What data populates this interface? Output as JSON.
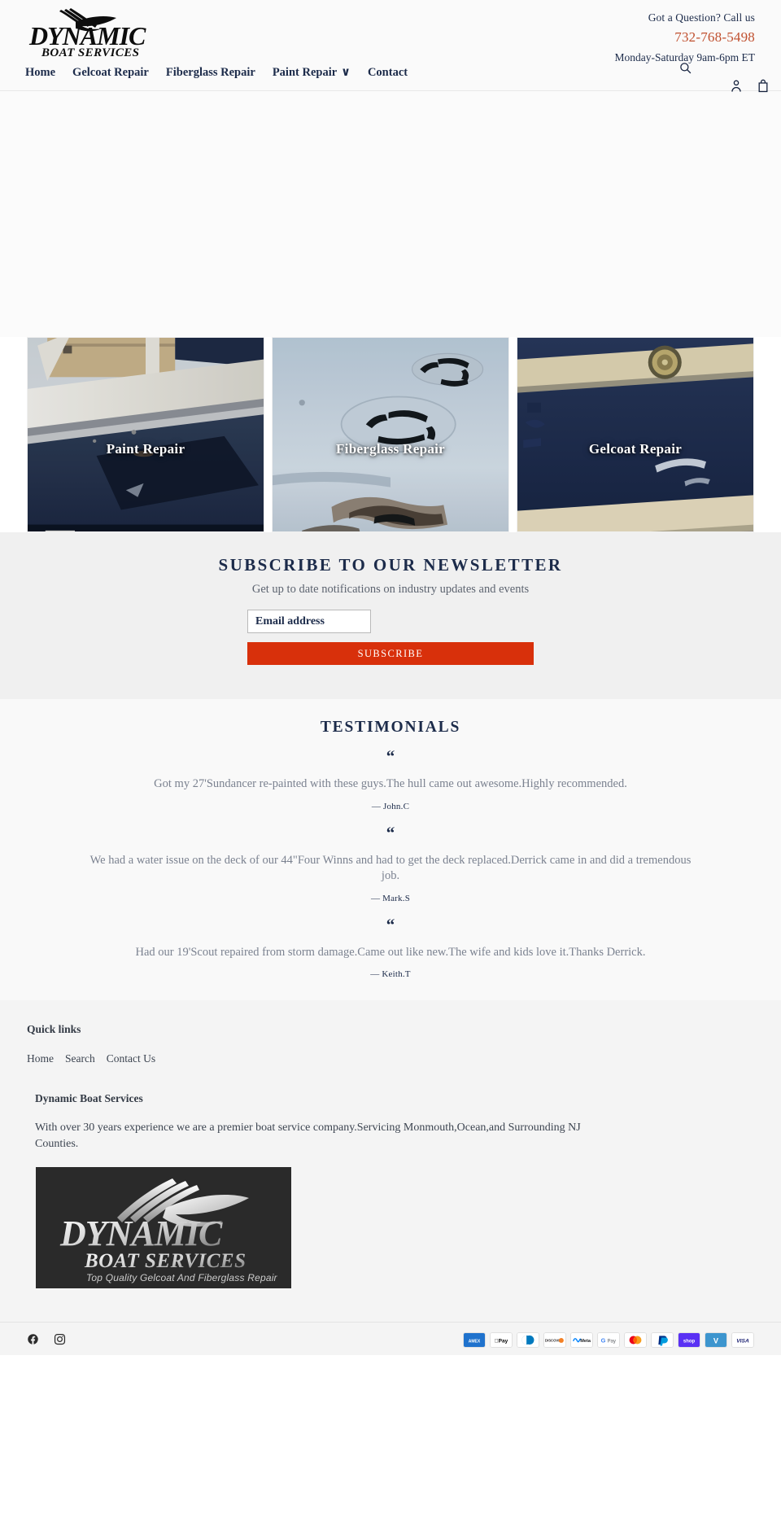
{
  "header": {
    "logo_alt": "Dynamic Boat Services",
    "logo_main": "DYNAMIC",
    "logo_sub": "BOAT SERVICES",
    "contact_prompt": "Got a Question? Call us",
    "phone": "732-768-5498",
    "hours": "Monday-Saturday 9am-6pm ET",
    "nav": [
      {
        "label": "Home",
        "has_caret": false
      },
      {
        "label": "Gelcoat Repair",
        "has_caret": false
      },
      {
        "label": "Fiberglass Repair",
        "has_caret": false
      },
      {
        "label": "Paint Repair",
        "has_caret": true
      },
      {
        "label": "Contact",
        "has_caret": false
      }
    ],
    "caret_glyph": "∨",
    "icons": {
      "search": "search-icon",
      "account": "account-icon",
      "cart": "cart-icon"
    }
  },
  "cards": [
    {
      "label": "Paint Repair"
    },
    {
      "label": "Fiberglass Repair"
    },
    {
      "label": "Gelcoat Repair"
    }
  ],
  "newsletter": {
    "title": "SUBSCRIBE TO OUR NEWSLETTER",
    "subtitle": "Get up to date notifications on industry updates and events",
    "email_placeholder": "Email address",
    "email_value": "",
    "submit_label": "SUBSCRIBE",
    "accent_color": "#d8300b"
  },
  "testimonials": {
    "title": "TESTIMONIALS",
    "quote_glyph": "“",
    "items": [
      {
        "text": "Got my 27'Sundancer re-painted with these guys.The hull came out awesome.Highly recommended.",
        "author": "— John.C"
      },
      {
        "text": "We had a water issue on the deck of our 44\"Four Winns and had to get the deck replaced.Derrick came in and did a tremendous job.",
        "author": "— Mark.S"
      },
      {
        "text": "Had our 19'Scout repaired from storm damage.Came out like new.The wife and kids love it.Thanks Derrick.",
        "author": "— Keith.T"
      }
    ]
  },
  "footer": {
    "quick_links_heading": "Quick links",
    "quick_links": [
      {
        "label": "Home"
      },
      {
        "label": "Search"
      },
      {
        "label": "Contact Us"
      }
    ],
    "business_name": "Dynamic Boat Services",
    "business_desc": "With over 30 years experience we are a premier boat service company.Servicing Monmouth,Ocean,and Surrounding NJ Counties.",
    "logo_image": {
      "main": "DYNAMIC",
      "sub": "BOAT SERVICES",
      "tagline": "Top Quality Gelcoat And Fiberglass Repair",
      "background": "#2a2a2a"
    },
    "social": [
      {
        "name": "facebook-icon"
      },
      {
        "name": "instagram-icon"
      }
    ],
    "payment_methods": [
      {
        "name": "amex",
        "label": "AMEX"
      },
      {
        "name": "apple-pay",
        "label": "Pay"
      },
      {
        "name": "diners-club",
        "label": ""
      },
      {
        "name": "discover",
        "label": "DISCOVER"
      },
      {
        "name": "meta-pay",
        "label": "Meta"
      },
      {
        "name": "google-pay",
        "label": "Pay"
      },
      {
        "name": "mastercard",
        "label": ""
      },
      {
        "name": "paypal",
        "label": "P"
      },
      {
        "name": "shop-pay",
        "label": "shop"
      },
      {
        "name": "venmo",
        "label": "V"
      },
      {
        "name": "visa",
        "label": "VISA"
      }
    ]
  }
}
